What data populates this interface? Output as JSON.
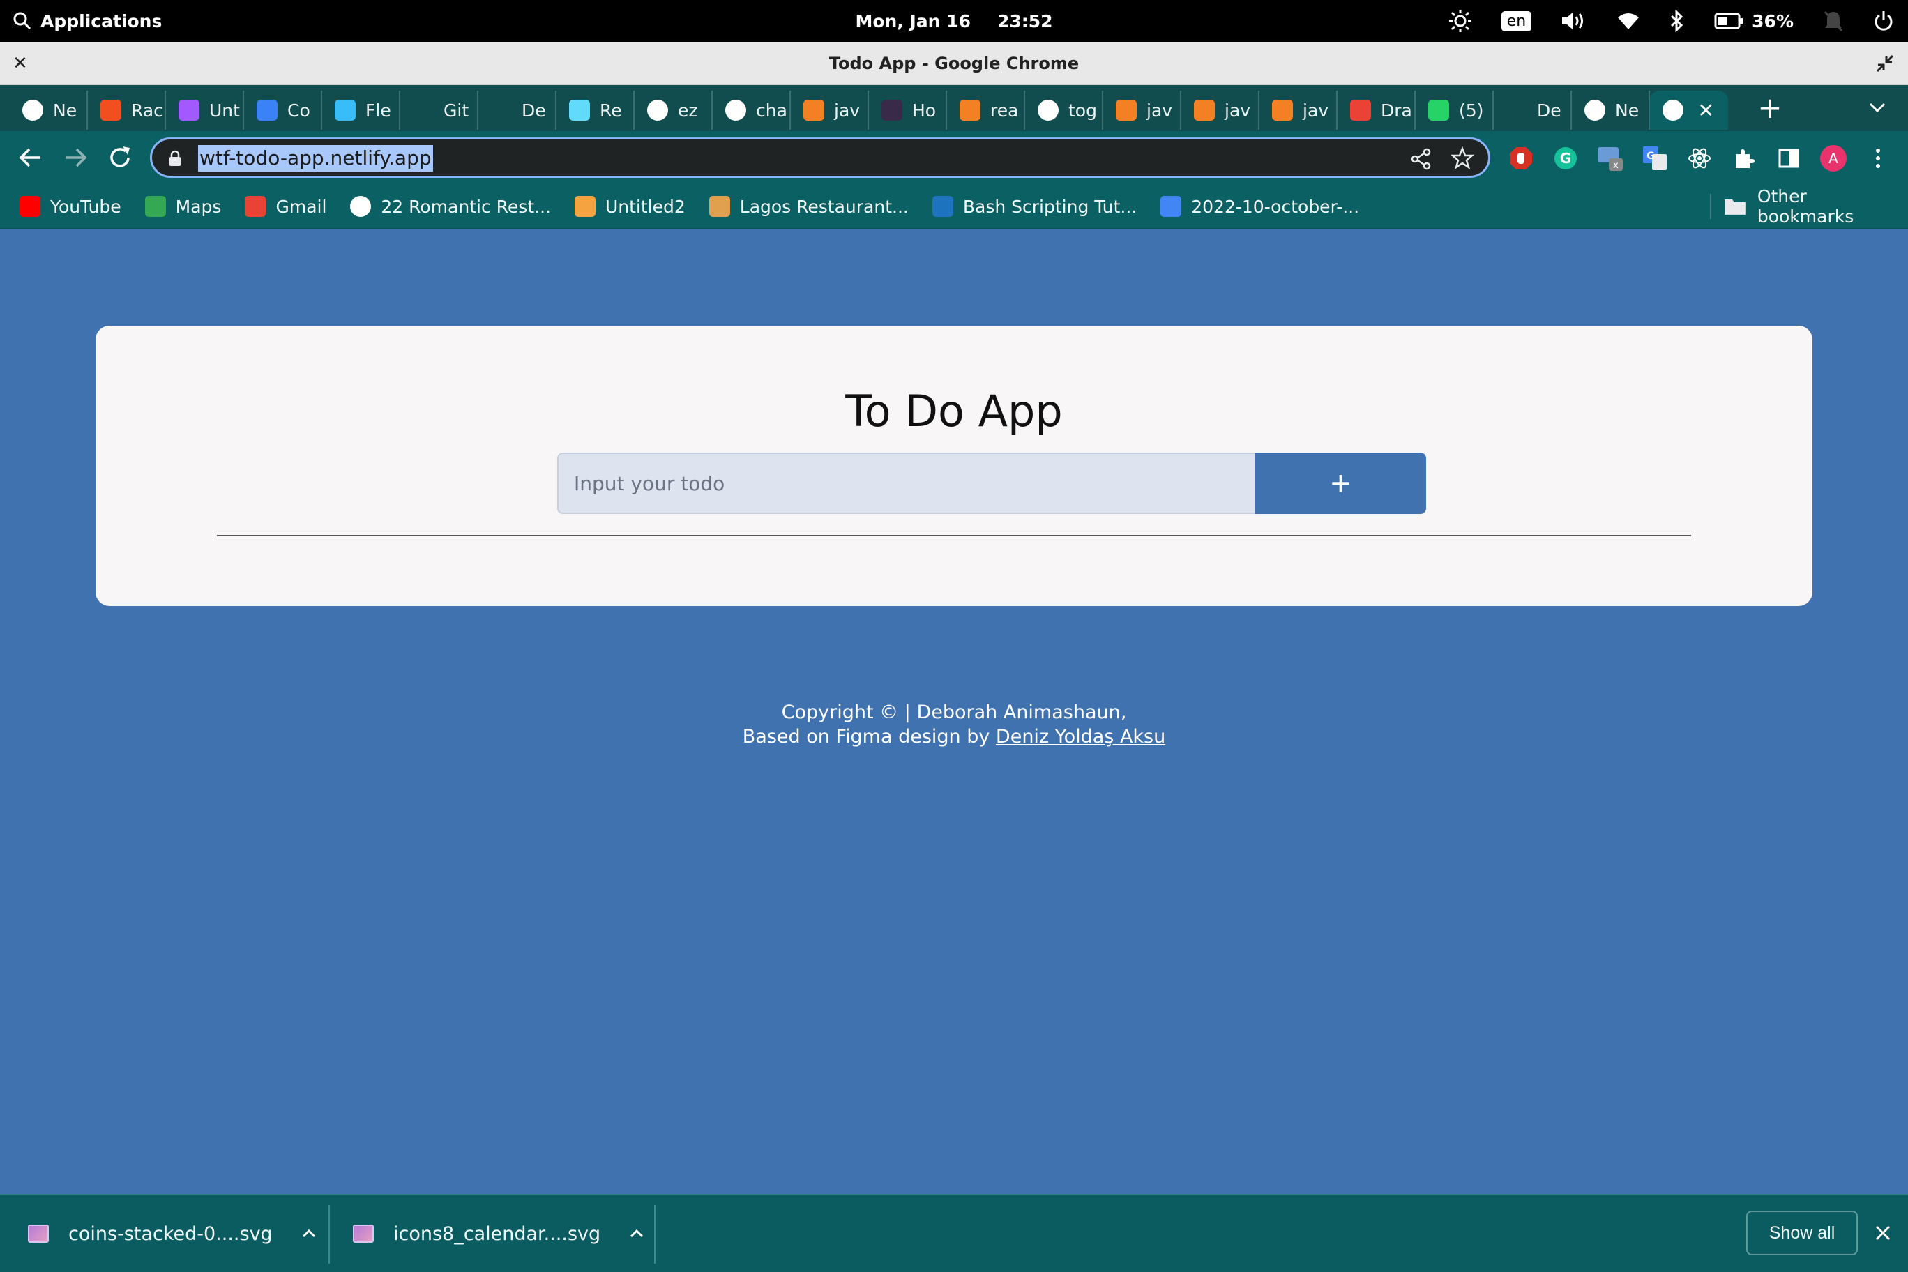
{
  "topbar": {
    "applications": "Applications",
    "date": "Mon, Jan 16",
    "time": "23:52",
    "language": "en",
    "battery": "36%"
  },
  "window": {
    "title": "Todo App - Google Chrome"
  },
  "tabs": [
    {
      "label": "Ne",
      "icon": "chrome-icon",
      "color": "#ffffff"
    },
    {
      "label": "Rac",
      "icon": "figma-icon",
      "color": "#f24e1e"
    },
    {
      "label": "Unt",
      "icon": "figma-icon",
      "color": "#a259ff"
    },
    {
      "label": "Co",
      "icon": "repo-icon",
      "color": "#3b82f6"
    },
    {
      "label": "Fle",
      "icon": "tailwind-icon",
      "color": "#38bdf8"
    },
    {
      "label": "Git",
      "icon": "github-icon",
      "color": "#114d4f"
    },
    {
      "label": "De",
      "icon": "github-icon",
      "color": "#114d4f"
    },
    {
      "label": "Re",
      "icon": "react-icon",
      "color": "#61dafb"
    },
    {
      "label": "ez",
      "icon": "globe-icon",
      "color": "#ffffff"
    },
    {
      "label": "cha",
      "icon": "google-icon",
      "color": "#ffffff"
    },
    {
      "label": "jav",
      "icon": "stackoverflow-icon",
      "color": "#f48024"
    },
    {
      "label": "Ho",
      "icon": "ss-icon",
      "color": "#3a2a4a"
    },
    {
      "label": "rea",
      "icon": "stackoverflow-icon",
      "color": "#f48024"
    },
    {
      "label": "tog",
      "icon": "google-icon",
      "color": "#ffffff"
    },
    {
      "label": "jav",
      "icon": "stackoverflow-icon",
      "color": "#f48024"
    },
    {
      "label": "jav",
      "icon": "stackoverflow-icon",
      "color": "#f48024"
    },
    {
      "label": "jav",
      "icon": "stackoverflow-icon",
      "color": "#f48024"
    },
    {
      "label": "Dra",
      "icon": "gmail-icon",
      "color": "#ea4335"
    },
    {
      "label": "(5)",
      "icon": "whatsapp-icon",
      "color": "#25d366"
    },
    {
      "label": "De",
      "icon": "github-icon",
      "color": "#114d4f"
    },
    {
      "label": "Ne",
      "icon": "chrome-icon",
      "color": "#ffffff"
    }
  ],
  "omnibox": {
    "url": "wtf-todo-app.netlify.app"
  },
  "bookmarks": [
    {
      "label": "YouTube",
      "icon": "youtube-icon",
      "color": "#ff0000"
    },
    {
      "label": "Maps",
      "icon": "maps-icon",
      "color": "#34a853"
    },
    {
      "label": "Gmail",
      "icon": "gmail-icon",
      "color": "#ea4335"
    },
    {
      "label": "22 Romantic Rest...",
      "icon": "globe-icon",
      "color": "#ffffff"
    },
    {
      "label": "Untitled2",
      "icon": "hourglass-icon",
      "color": "#f4a340"
    },
    {
      "label": "Lagos Restaurant...",
      "icon": "food-icon",
      "color": "#e0a050"
    },
    {
      "label": "Bash Scripting Tut...",
      "icon": "lc-icon",
      "color": "#1e73be"
    },
    {
      "label": "2022-10-october-...",
      "icon": "docs-icon",
      "color": "#4285f4"
    }
  ],
  "other_bookmarks": "Other bookmarks",
  "app": {
    "title": "To Do App",
    "input_placeholder": "Input your todo",
    "add_button": "+",
    "footer_line1": "Copyright © | Deborah Animashaun,",
    "footer_line2_prefix": "Based on Figma design by ",
    "footer_link": "Deniz Yoldaş Aksu"
  },
  "downloads": {
    "items": [
      "coins-stacked-0....svg",
      "icons8_calendar....svg"
    ],
    "show_all": "Show all"
  },
  "colors": {
    "page_background": "#4172b0",
    "card_background": "#f8f6f6",
    "button": "#4172b0",
    "browser_chrome": "#0b6063"
  }
}
